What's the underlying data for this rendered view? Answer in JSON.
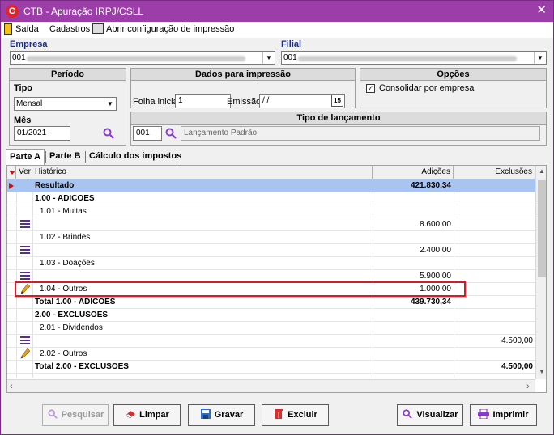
{
  "window": {
    "title": "CTB - Apuração IRPJ/CSLL",
    "app_icon_letter": "G",
    "close_glyph": "✕"
  },
  "menu": {
    "exit": "Saída",
    "registers": "Cadastros",
    "print_config": "Abrir configuração de impressão"
  },
  "empresa": {
    "label": "Empresa",
    "code": "001"
  },
  "filial": {
    "label": "Filial",
    "code": "001"
  },
  "periodo": {
    "header": "Período",
    "tipo_label": "Tipo",
    "tipo_value": "Mensal",
    "mes_label": "Mês",
    "mes_value": "01/2021"
  },
  "dados_impressao": {
    "header": "Dados para impressão",
    "folha_label": "Folha inicial",
    "folha_value": "1",
    "emissao_label": "Emissão",
    "emissao_value": " / /",
    "calendar_label": "15"
  },
  "opcoes": {
    "header": "Opções",
    "consolidar_label": "Consolidar por empresa",
    "consolidar_checked": true
  },
  "tipo_lancamento": {
    "header": "Tipo de lançamento",
    "code": "001",
    "description": "Lançamento Padrão"
  },
  "tabs": [
    "Parte A",
    "Parte B",
    "Cálculo dos impostos"
  ],
  "grid": {
    "columns": {
      "ver": "Ver",
      "historico": "Histórico",
      "adicoes": "Adições",
      "exclusoes": "Exclusões"
    },
    "rows": [
      {
        "indicator": true,
        "icon": "",
        "historico": "Resultado",
        "adicoes": "421.830,34",
        "exclusoes": "",
        "bold": true,
        "indent": 0,
        "selected": true
      },
      {
        "indicator": false,
        "icon": "",
        "historico": "1.00 - ADICOES",
        "adicoes": "",
        "exclusoes": "",
        "bold": true,
        "indent": 0,
        "selected": false
      },
      {
        "indicator": false,
        "icon": "",
        "historico": "1.01 - Multas",
        "adicoes": "",
        "exclusoes": "",
        "bold": false,
        "indent": 6,
        "selected": false
      },
      {
        "indicator": false,
        "icon": "list",
        "historico": "",
        "adicoes": "8.600,00",
        "exclusoes": "",
        "bold": false,
        "indent": 0,
        "selected": false
      },
      {
        "indicator": false,
        "icon": "",
        "historico": "1.02 - Brindes",
        "adicoes": "",
        "exclusoes": "",
        "bold": false,
        "indent": 6,
        "selected": false
      },
      {
        "indicator": false,
        "icon": "list",
        "historico": "",
        "adicoes": "2.400,00",
        "exclusoes": "",
        "bold": false,
        "indent": 0,
        "selected": false
      },
      {
        "indicator": false,
        "icon": "",
        "historico": "1.03 - Doações",
        "adicoes": "",
        "exclusoes": "",
        "bold": false,
        "indent": 6,
        "selected": false
      },
      {
        "indicator": false,
        "icon": "list",
        "historico": "",
        "adicoes": "5.900,00",
        "exclusoes": "",
        "bold": false,
        "indent": 0,
        "selected": false
      },
      {
        "indicator": false,
        "icon": "pencil",
        "historico": "1.04 - Outros",
        "adicoes": "1.000,00",
        "exclusoes": "",
        "bold": false,
        "indent": 6,
        "selected": false
      },
      {
        "indicator": false,
        "icon": "",
        "historico": "Total 1.00 - ADICOES",
        "adicoes": "439.730,34",
        "exclusoes": "",
        "bold": true,
        "indent": 0,
        "selected": false
      },
      {
        "indicator": false,
        "icon": "",
        "historico": "2.00 - EXCLUSOES",
        "adicoes": "",
        "exclusoes": "",
        "bold": true,
        "indent": 0,
        "selected": false
      },
      {
        "indicator": false,
        "icon": "",
        "historico": "2.01 - Dividendos",
        "adicoes": "",
        "exclusoes": "",
        "bold": false,
        "indent": 6,
        "selected": false
      },
      {
        "indicator": false,
        "icon": "list",
        "historico": "",
        "adicoes": "",
        "exclusoes": "4.500,00",
        "bold": false,
        "indent": 0,
        "selected": false
      },
      {
        "indicator": false,
        "icon": "pencil",
        "historico": "2.02 - Outros",
        "adicoes": "",
        "exclusoes": "",
        "bold": false,
        "indent": 6,
        "selected": false
      },
      {
        "indicator": false,
        "icon": "",
        "historico": "Total 2.00 - EXCLUSOES",
        "adicoes": "",
        "exclusoes": "4.500,00",
        "bold": true,
        "indent": 0,
        "selected": false
      }
    ]
  },
  "buttons": {
    "pesquisar": "Pesquisar",
    "limpar": "Limpar",
    "gravar": "Gravar",
    "excluir": "Excluir",
    "visualizar": "Visualizar",
    "imprimir": "Imprimir"
  },
  "colors": {
    "titlebar": "#9b3ea8",
    "selected_row": "#a7c5f0",
    "highlight_box": "#d41b2c",
    "label_blue": "#1b2f8a"
  }
}
